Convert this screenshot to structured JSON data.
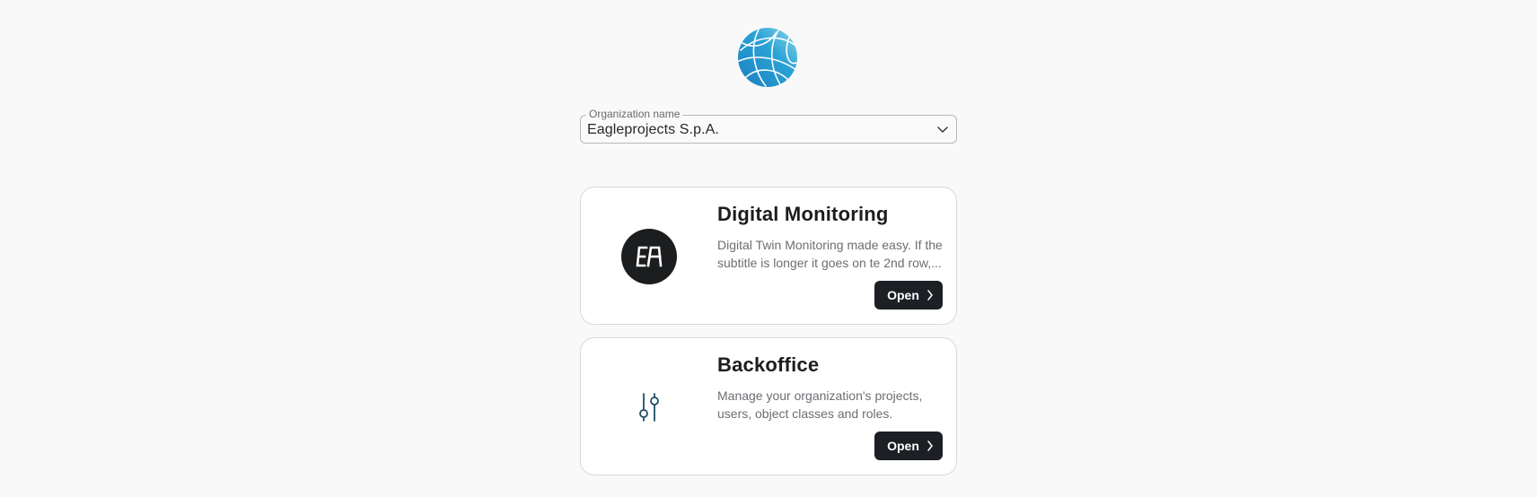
{
  "organization": {
    "label": "Organization name",
    "selected": "Eagleprojects S.p.A."
  },
  "apps": [
    {
      "title": "Digital Monitoring",
      "description": "Digital Twin Monitoring made easy. If the subtitle is longer it goes on te 2nd row,...",
      "icon": "ea-logo-icon",
      "button": "Open"
    },
    {
      "title": "Backoffice",
      "description": "Manage your organization's projects, users, object classes and roles.",
      "icon": "sliders-icon",
      "button": "Open"
    }
  ],
  "colors": {
    "background": "#f9f9f9",
    "button": "#1c1f23",
    "globe": "#2a9fd0",
    "slider_icon": "#1f4e66"
  }
}
